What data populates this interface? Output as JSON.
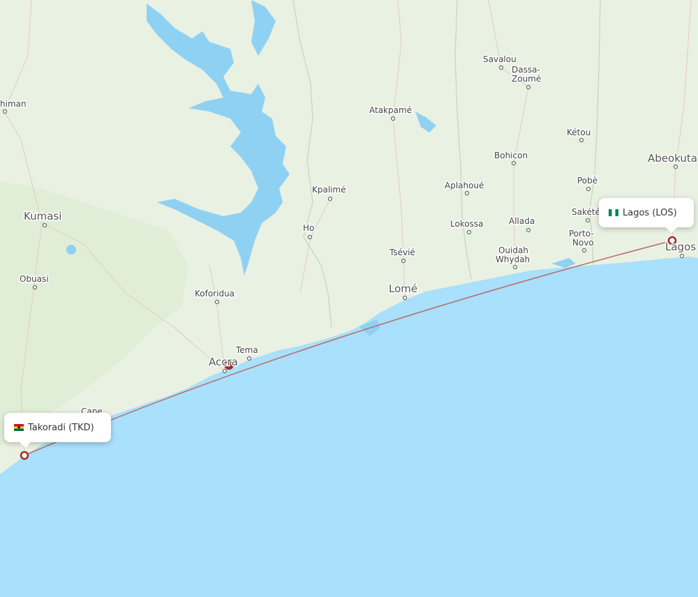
{
  "origin": {
    "name": "Takoradi (TKD)",
    "flag": "ghana-flag-icon"
  },
  "destination": {
    "name": "Lagos (LOS)",
    "flag": "nigeria-flag-icon"
  },
  "colors": {
    "sea": "#a9e0fb",
    "land": "#e9f1e2",
    "route": "#b86a6a",
    "marker": "#9c2a2a",
    "lake": "#8fd1f3"
  },
  "cities": {
    "kumasi": "Kumasi",
    "obuasi": "Obuasi",
    "koforidua": "Koforidua",
    "accra": "Accra",
    "tema": "Tema",
    "cape": "Cape",
    "takoradi": "Takoradi",
    "ho": "Ho",
    "kpalime": "Kpalimé",
    "atakpame": "Atakpamé",
    "tsevie": "Tsévié",
    "lome": "Lomé",
    "savalou": "Savalou",
    "dassa1": "Dassa-",
    "dassa2": "Zoumé",
    "bohicon": "Bohicon",
    "aplahoue": "Aplahoué",
    "lokossa": "Lokossa",
    "allada": "Allada",
    "ouidah": "Ouidah",
    "whydah": "Whydah",
    "ketou": "Kétou",
    "pobe": "Pobè",
    "sakete": "Sakété",
    "porto": "Porto-",
    "novo": "Novo",
    "abeokuta": "Abeokuta",
    "lagos": "Lagos",
    "ahiman": "himan"
  }
}
